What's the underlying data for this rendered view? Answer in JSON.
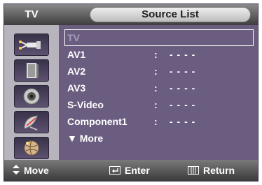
{
  "header": {
    "mode_label": "TV",
    "menu_title": "Source List"
  },
  "sidebar": {
    "items": [
      {
        "icon": "antenna-input-icon"
      },
      {
        "icon": "speaker-icon"
      },
      {
        "icon": "disc-icon"
      },
      {
        "icon": "satellite-dish-icon"
      },
      {
        "icon": "globe-icon"
      }
    ]
  },
  "sources": [
    {
      "name": "TV",
      "colon": "",
      "value": ""
    },
    {
      "name": "AV1",
      "colon": ":",
      "value": "- - - -"
    },
    {
      "name": "AV2",
      "colon": ":",
      "value": "- - - -"
    },
    {
      "name": "AV3",
      "colon": ":",
      "value": "- - - -"
    },
    {
      "name": "S-Video",
      "colon": ":",
      "value": "- - - -"
    },
    {
      "name": "Component1",
      "colon": ":",
      "value": "- - - -"
    }
  ],
  "more": {
    "label": "▼ More"
  },
  "footer": {
    "move_label": "Move",
    "enter_label": "Enter",
    "return_label": "Return"
  },
  "colors": {
    "panel": "#6b5d80",
    "sidebar": "#b7b4bd",
    "selected_text": "#a79cb8"
  }
}
